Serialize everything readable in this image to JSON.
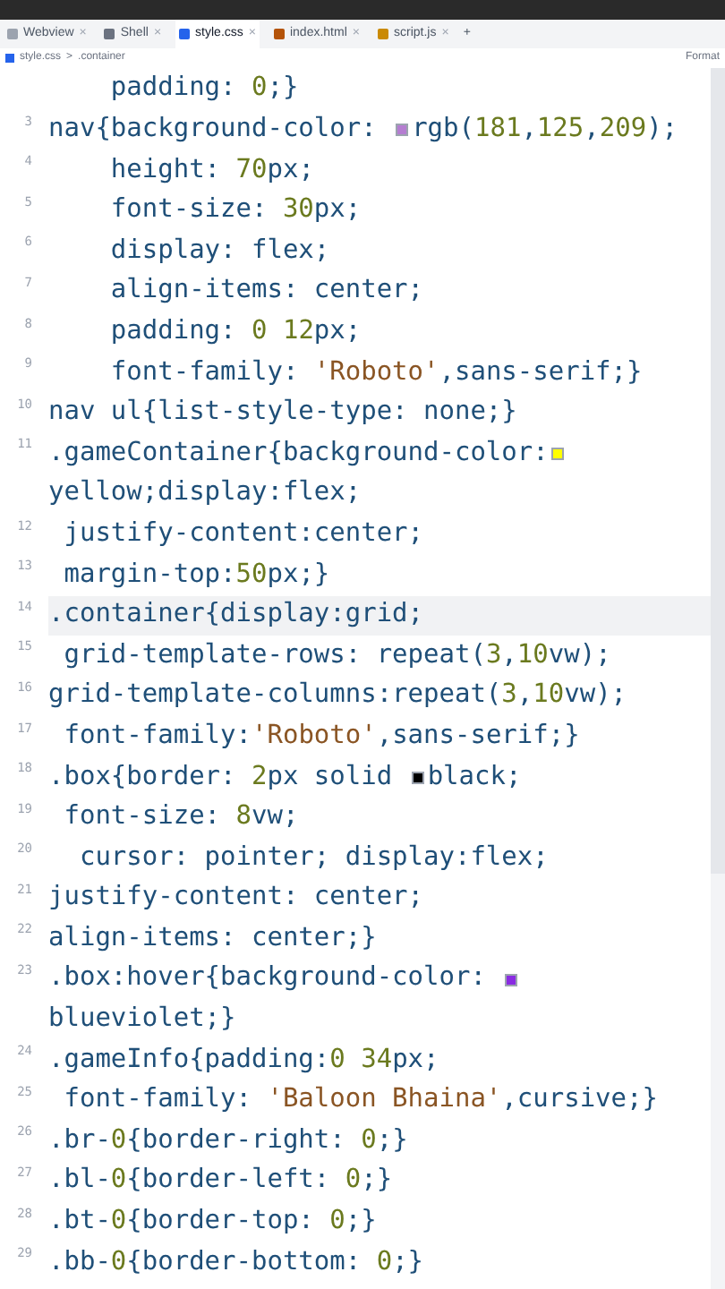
{
  "tabs": [
    {
      "label": "Webview",
      "close": "×",
      "selected": false
    },
    {
      "label": "Shell",
      "close": "×",
      "selected": false
    },
    {
      "label": "style.css",
      "close": "×",
      "selected": true
    },
    {
      "label": "index.html",
      "close": "×",
      "selected": false
    },
    {
      "label": "script.js",
      "close": "×",
      "selected": false
    }
  ],
  "new_tab": "+",
  "breadcrumb": {
    "file": "style.css",
    "separator": ">",
    "symbol": ".container",
    "action": "Format"
  },
  "code_lines": [
    {
      "current": false,
      "tokens": [
        {
          "kind": "t",
          "text": "    padding: "
        },
        {
          "kind": "n",
          "text": "0"
        },
        {
          "kind": "t",
          "text": ";}"
        }
      ]
    },
    {
      "number": "3",
      "current": false,
      "tokens": [
        {
          "kind": "t",
          "text": "nav{background-color: "
        },
        {
          "kind": "sw",
          "color": "#b57dd1"
        },
        {
          "kind": "t",
          "text": "rgb("
        },
        {
          "kind": "n",
          "text": "181"
        },
        {
          "kind": "t",
          "text": ","
        },
        {
          "kind": "n",
          "text": "125"
        },
        {
          "kind": "t",
          "text": ","
        },
        {
          "kind": "n",
          "text": "209"
        },
        {
          "kind": "t",
          "text": ");"
        }
      ]
    },
    {
      "number": "4",
      "current": false,
      "tokens": [
        {
          "kind": "t",
          "text": "    height: "
        },
        {
          "kind": "n",
          "text": "70"
        },
        {
          "kind": "t",
          "text": "px;"
        }
      ]
    },
    {
      "number": "5",
      "current": false,
      "tokens": [
        {
          "kind": "t",
          "text": "    font-size: "
        },
        {
          "kind": "n",
          "text": "30"
        },
        {
          "kind": "t",
          "text": "px;"
        }
      ]
    },
    {
      "number": "6",
      "current": false,
      "tokens": [
        {
          "kind": "t",
          "text": "    display: flex;"
        }
      ]
    },
    {
      "number": "7",
      "current": false,
      "tokens": [
        {
          "kind": "t",
          "text": "    align-items: center;"
        }
      ]
    },
    {
      "number": "8",
      "current": false,
      "tokens": [
        {
          "kind": "t",
          "text": "    padding: "
        },
        {
          "kind": "n",
          "text": "0 12"
        },
        {
          "kind": "t",
          "text": "px;"
        }
      ]
    },
    {
      "number": "9",
      "current": false,
      "tokens": [
        {
          "kind": "t",
          "text": "    font-family: "
        },
        {
          "kind": "s",
          "text": "'Roboto'"
        },
        {
          "kind": "t",
          "text": ",sans-serif;}"
        }
      ]
    },
    {
      "number": "10",
      "current": false,
      "tokens": [
        {
          "kind": "t",
          "text": "nav ul{list-style-type: none;}"
        }
      ]
    },
    {
      "number": "11",
      "current": false,
      "tokens": [
        {
          "kind": "t",
          "text": ".gameContainer{background-color:"
        },
        {
          "kind": "sw",
          "color": "#ffff00"
        }
      ]
    },
    {
      "current": false,
      "tokens": [
        {
          "kind": "t",
          "text": "yellow;display:flex;"
        }
      ]
    },
    {
      "number": "12",
      "current": false,
      "tokens": [
        {
          "kind": "t",
          "text": " justify-content:center;"
        }
      ]
    },
    {
      "number": "13",
      "current": false,
      "tokens": [
        {
          "kind": "t",
          "text": " margin-top:"
        },
        {
          "kind": "n",
          "text": "50"
        },
        {
          "kind": "t",
          "text": "px;}"
        }
      ]
    },
    {
      "number": "14",
      "current": true,
      "tokens": [
        {
          "kind": "t",
          "text": ".container{display:grid;"
        }
      ]
    },
    {
      "number": "15",
      "current": false,
      "tokens": [
        {
          "kind": "t",
          "text": " grid-template-rows: repeat("
        },
        {
          "kind": "n",
          "text": "3"
        },
        {
          "kind": "t",
          "text": ","
        },
        {
          "kind": "n",
          "text": "10"
        },
        {
          "kind": "t",
          "text": "vw);"
        }
      ]
    },
    {
      "number": "16",
      "current": false,
      "tokens": [
        {
          "kind": "t",
          "text": "grid-template-columns:repeat("
        },
        {
          "kind": "n",
          "text": "3"
        },
        {
          "kind": "t",
          "text": ","
        },
        {
          "kind": "n",
          "text": "10"
        },
        {
          "kind": "t",
          "text": "vw);"
        }
      ]
    },
    {
      "number": "17",
      "current": false,
      "tokens": [
        {
          "kind": "t",
          "text": " font-family:"
        },
        {
          "kind": "s",
          "text": "'Roboto'"
        },
        {
          "kind": "t",
          "text": ",sans-serif;}"
        }
      ]
    },
    {
      "number": "18",
      "current": false,
      "tokens": [
        {
          "kind": "t",
          "text": ".box{border: "
        },
        {
          "kind": "n",
          "text": "2"
        },
        {
          "kind": "t",
          "text": "px solid "
        },
        {
          "kind": "sw",
          "color": "#000000"
        },
        {
          "kind": "t",
          "text": "black;"
        }
      ]
    },
    {
      "number": "19",
      "current": false,
      "tokens": [
        {
          "kind": "t",
          "text": " font-size: "
        },
        {
          "kind": "n",
          "text": "8"
        },
        {
          "kind": "t",
          "text": "vw;"
        }
      ]
    },
    {
      "number": "20",
      "current": false,
      "tokens": [
        {
          "kind": "t",
          "text": "  cursor: pointer; display:flex;"
        }
      ]
    },
    {
      "number": "21",
      "current": false,
      "tokens": [
        {
          "kind": "t",
          "text": "justify-content: center;"
        }
      ]
    },
    {
      "number": "22",
      "current": false,
      "tokens": [
        {
          "kind": "t",
          "text": "align-items: center;}"
        }
      ]
    },
    {
      "number": "23",
      "current": false,
      "tokens": [
        {
          "kind": "t",
          "text": ".box:hover{background-color: "
        },
        {
          "kind": "sw",
          "color": "#8a2be2"
        }
      ]
    },
    {
      "current": false,
      "tokens": [
        {
          "kind": "t",
          "text": "blueviolet;}"
        }
      ]
    },
    {
      "number": "24",
      "current": false,
      "tokens": [
        {
          "kind": "t",
          "text": ".gameInfo{padding:"
        },
        {
          "kind": "n",
          "text": "0 34"
        },
        {
          "kind": "t",
          "text": "px;"
        }
      ]
    },
    {
      "number": "25",
      "current": false,
      "tokens": [
        {
          "kind": "t",
          "text": " font-family: "
        },
        {
          "kind": "s",
          "text": "'Baloon Bhaina'"
        },
        {
          "kind": "t",
          "text": ",cursive;}"
        }
      ]
    },
    {
      "number": "26",
      "current": false,
      "tokens": [
        {
          "kind": "t",
          "text": ".br-"
        },
        {
          "kind": "n",
          "text": "0"
        },
        {
          "kind": "t",
          "text": "{border-right: "
        },
        {
          "kind": "n",
          "text": "0"
        },
        {
          "kind": "t",
          "text": ";}"
        }
      ]
    },
    {
      "number": "27",
      "current": false,
      "tokens": [
        {
          "kind": "t",
          "text": ".bl-"
        },
        {
          "kind": "n",
          "text": "0"
        },
        {
          "kind": "t",
          "text": "{border-left: "
        },
        {
          "kind": "n",
          "text": "0"
        },
        {
          "kind": "t",
          "text": ";}"
        }
      ]
    },
    {
      "number": "28",
      "current": false,
      "tokens": [
        {
          "kind": "t",
          "text": ".bt-"
        },
        {
          "kind": "n",
          "text": "0"
        },
        {
          "kind": "t",
          "text": "{border-top: "
        },
        {
          "kind": "n",
          "text": "0"
        },
        {
          "kind": "t",
          "text": ";}"
        }
      ]
    },
    {
      "number": "29",
      "current": false,
      "tokens": [
        {
          "kind": "t",
          "text": ".bb-"
        },
        {
          "kind": "n",
          "text": "0"
        },
        {
          "kind": "t",
          "text": "{border-bottom: "
        },
        {
          "kind": "n",
          "text": "0"
        },
        {
          "kind": "t",
          "text": ";}"
        }
      ]
    }
  ]
}
